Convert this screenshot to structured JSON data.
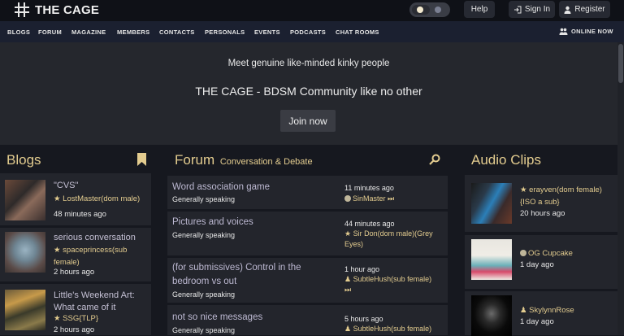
{
  "header": {
    "logo_text": "THE CAGE",
    "help": "Help",
    "signin": "Sign In",
    "register": "Register"
  },
  "nav": {
    "items": [
      "BLOGS",
      "FORUM",
      "MAGAZINE",
      "MEMBERS",
      "CONTACTS",
      "PERSONALS",
      "EVENTS",
      "PODCASTS",
      "CHAT ROOMS"
    ],
    "online": "ONLINE NOW"
  },
  "hero": {
    "subtitle": "Meet genuine like-minded kinky people",
    "title": "THE CAGE - BDSM Community like no other",
    "join": "Join now"
  },
  "blogs": {
    "title": "Blogs",
    "items": [
      {
        "title": "\"CVS\"",
        "author": "LostMaster(dom male)",
        "time": "48 minutes ago"
      },
      {
        "title": "serious conversation",
        "author": "spaceprincess(sub female)",
        "time": "2 hours ago"
      },
      {
        "title": "Little's Weekend Art: What came of it",
        "author": "SSG{TLP}",
        "time": "2 hours ago"
      }
    ]
  },
  "forum": {
    "title": "Forum",
    "subtitle": "Conversation & Debate",
    "items": [
      {
        "title": "Word association game",
        "category": "Generally speaking",
        "time": "11 minutes ago",
        "author": "SinMaster"
      },
      {
        "title": "Pictures and voices",
        "category": "Generally speaking",
        "time": "44 minutes ago",
        "author": "Sir Don(dom male)(Grey Eyes)"
      },
      {
        "title": "(for submissives) Control in the bedroom vs out",
        "category": "Generally speaking",
        "time": "1 hour ago",
        "author": "SubtleHush(sub female)"
      },
      {
        "title": "not so nice messages",
        "category": "Generally speaking",
        "time": "5 hours ago",
        "author": "SubtleHush(sub female)"
      }
    ]
  },
  "audio": {
    "title": "Audio Clips",
    "items": [
      {
        "author": "erayven(dom female){ISO a sub}",
        "time": "20 hours ago"
      },
      {
        "author": "OG Cupcake",
        "time": "1 day ago"
      },
      {
        "author": "SkylynnRose",
        "time": "1 day ago"
      }
    ]
  },
  "colors": {
    "accent": "#e3cc8f",
    "background": "#16181f",
    "card": "#23252c",
    "nav": "#1b2030"
  }
}
